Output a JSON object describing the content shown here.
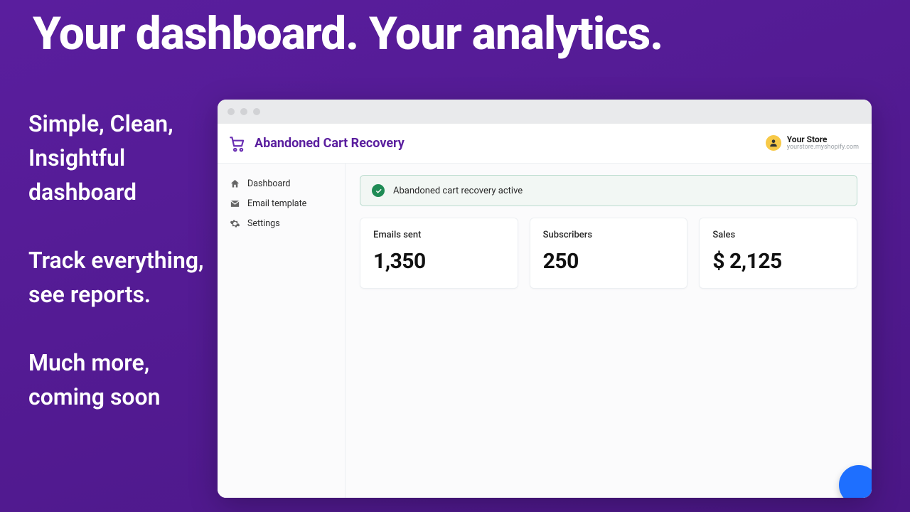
{
  "hero": {
    "title": "Your dashboard. Your analytics."
  },
  "side_copy": {
    "p1": "Simple, Clean, Insightful dashboard",
    "p2": "Track everything, see reports.",
    "p3": "Much more, coming soon"
  },
  "app": {
    "brand_title": "Abandoned Cart Recovery",
    "store": {
      "name": "Your Store",
      "url": "yourstore.myshopify.com"
    },
    "nav": {
      "dashboard": "Dashboard",
      "email_template": "Email template",
      "settings": "Settings"
    },
    "status_banner": "Abandoned cart recovery active",
    "cards": {
      "emails_sent": {
        "label": "Emails sent",
        "value": "1,350"
      },
      "subscribers": {
        "label": "Subscribers",
        "value": "250"
      },
      "sales": {
        "label": "Sales",
        "value": "$ 2,125"
      }
    }
  }
}
